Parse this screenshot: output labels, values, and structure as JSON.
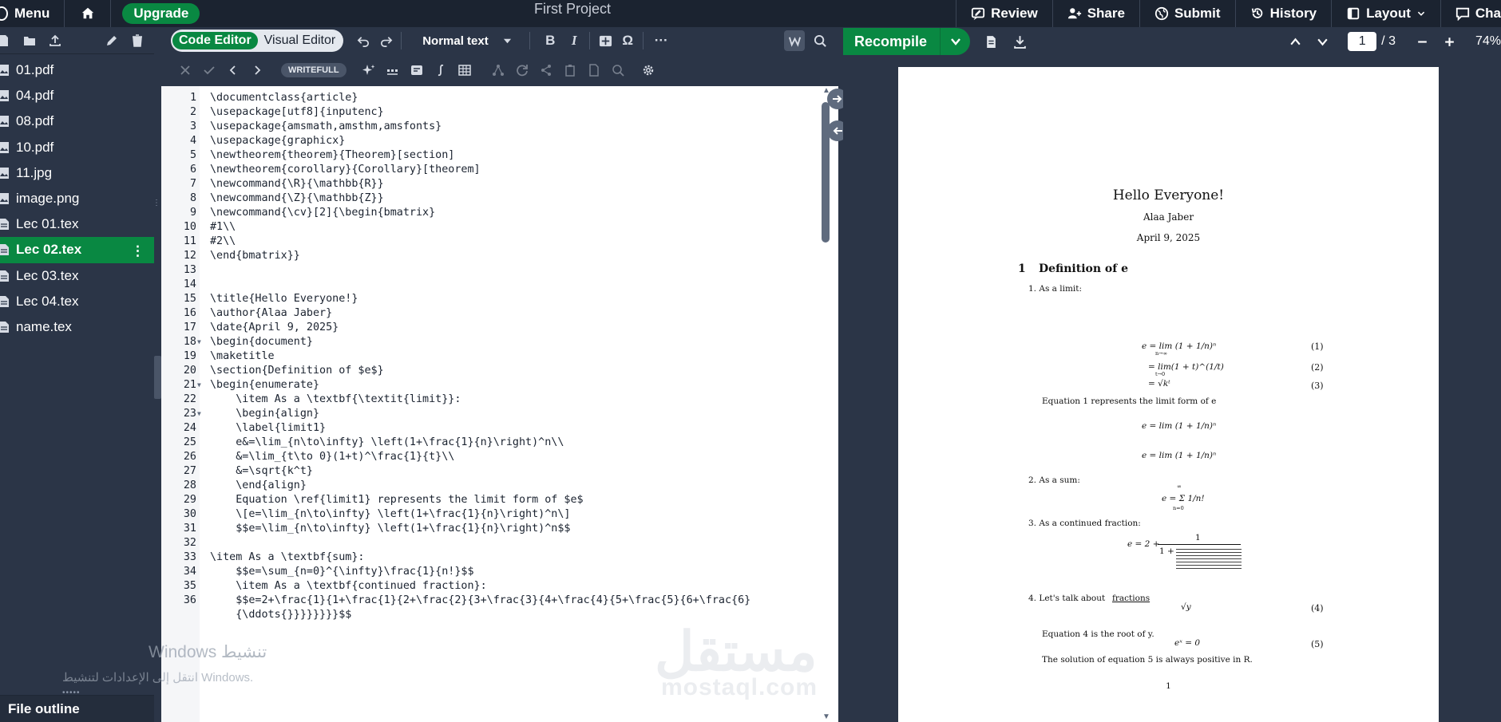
{
  "topbar": {
    "menu_label": "Menu",
    "upgrade_label": "Upgrade",
    "project_title": "First Project",
    "review_label": "Review",
    "share_label": "Share",
    "submit_label": "Submit",
    "history_label": "History",
    "layout_label": "Layout",
    "chat_label": "Cha"
  },
  "filetree": {
    "files": [
      "01.pdf",
      "04.pdf",
      "08.pdf",
      "10.pdf",
      "11.jpg",
      "image.png",
      "Lec 01.tex",
      "Lec 02.tex",
      "Lec 03.tex",
      "Lec 04.tex",
      "name.tex"
    ],
    "active_file": "Lec 02.tex",
    "outline_label": "File outline"
  },
  "editor_toolbar": {
    "code_editor_label": "Code Editor",
    "visual_editor_label": "Visual Editor",
    "paragraph_style": "Normal text",
    "bold_label": "B",
    "italic_label": "I",
    "symbol_label": "Ω",
    "more_label": "···",
    "writefull_label": "WRITEFULL"
  },
  "code_lines": [
    "\\documentclass{article}",
    "\\usepackage[utf8]{inputenc}",
    "\\usepackage{amsmath,amsthm,amsfonts}",
    "\\usepackage{graphicx}",
    "\\newtheorem{theorem}{Theorem}[section]",
    "\\newtheorem{corollary}{Corollary}[theorem]",
    "\\newcommand{\\R}{\\mathbb{R}}",
    "\\newcommand{\\Z}{\\mathbb{Z}}",
    "\\newcommand{\\cv}[2]{\\begin{bmatrix}",
    "#1\\\\",
    "#2\\\\",
    "\\end{bmatrix}}",
    "",
    "",
    "\\title{Hello Everyone!}",
    "\\author{Alaa Jaber}",
    "\\date{April 9, 2025}",
    "\\begin{document}",
    "\\maketitle",
    "\\section{Definition of $e$}",
    "\\begin{enumerate}",
    "    \\item As a \\textbf{\\textit{limit}}:",
    "    \\begin{align}",
    "    \\label{limit1}",
    "    e&=\\lim_{n\\to\\infty} \\left(1+\\frac{1}{n}\\right)^n\\\\",
    "    &=\\lim_{t\\to 0}(1+t)^\\frac{1}{t}\\\\",
    "    &=\\sqrt{k^t}",
    "    \\end{align}",
    "    Equation \\ref{limit1} represents the limit form of $e$",
    "    \\[e=\\lim_{n\\to\\infty} \\left(1+\\frac{1}{n}\\right)^n\\]",
    "    $$e=\\lim_{n\\to\\infty} \\left(1+\\frac{1}{n}\\right)^n$$",
    "",
    "\\item As a \\textbf{sum}:",
    "    $$e=\\sum_{n=0}^{\\infty}\\frac{1}{n!}$$",
    "    \\item As a \\textbf{continued fraction}:",
    "    $$e=2+\\frac{1}{1+\\frac{1}{2+\\frac{2}{3+\\frac{3}{4+\\frac{4}{5+\\frac{5}{6+\\frac{6}",
    "    {\\ddots{}}}}}}}}$$"
  ],
  "line_numbers": [
    "1",
    "2",
    "3",
    "4",
    "5",
    "6",
    "7",
    "8",
    "9",
    "10",
    "11",
    "12",
    "13",
    "14",
    "15",
    "16",
    "17",
    "18",
    "19",
    "20",
    "21",
    "22",
    "23",
    "24",
    "25",
    "26",
    "27",
    "28",
    "29",
    "30",
    "31",
    "32",
    "33",
    "34",
    "35",
    "36",
    ""
  ],
  "pdf_toolbar": {
    "recompile_label": "Recompile",
    "current_page": "1",
    "page_total": "/ 3",
    "zoom": "74%"
  },
  "pdf": {
    "title": "Hello Everyone!",
    "author": "Alaa Jaber",
    "date": "April 9, 2025",
    "section_number": "1",
    "section_title": "Definition of e",
    "item1": "1.  As a limit:",
    "eq1": "e = lim (1 + 1/n)ⁿ",
    "eq1_sub": "n→∞",
    "eq2": "= lim(1 + t)^(1/t)",
    "eq2_sub": "t→0",
    "eq3": "= √kᵗ",
    "eqno1": "(1)",
    "eqno2": "(2)",
    "eqno3": "(3)",
    "ref_text": "Equation 1 represents the limit form of e",
    "eq4": "e = lim (1 + 1/n)ⁿ",
    "eq5": "e = lim (1 + 1/n)ⁿ",
    "item2": "2.  As a sum:",
    "eq_sum": "e = Σ 1/n!",
    "eq_sum_top": "∞",
    "eq_sum_bottom": "n=0",
    "item3": "3.  As a continued fraction:",
    "eq_cf": "e = 2 +",
    "eq_cf_one": "1",
    "eq_cf_denom": "1 +",
    "item4_prefix": "4.  Let's talk about ",
    "item4_link": "fractions",
    "eq_root": "√y",
    "eqno4": "(4)",
    "root_text": "Equation 4 is the root of y.",
    "eq_exp": "eˣ = 0",
    "eqno5": "(5)",
    "solution_text": "The solution of equation 5 is always positive in R.",
    "page_number": "1"
  },
  "watermarks": {
    "windows_line1": "Windows تنشيط",
    "windows_line2": "انتقل إلى الإعدادات لتنشيط Windows.",
    "mostaql_ar": "مستقل",
    "mostaql_en": "mostaql.com"
  },
  "colors": {
    "brand_green": "#098842",
    "dark_bg": "#1b2330",
    "panel_bg": "#2b3547"
  }
}
